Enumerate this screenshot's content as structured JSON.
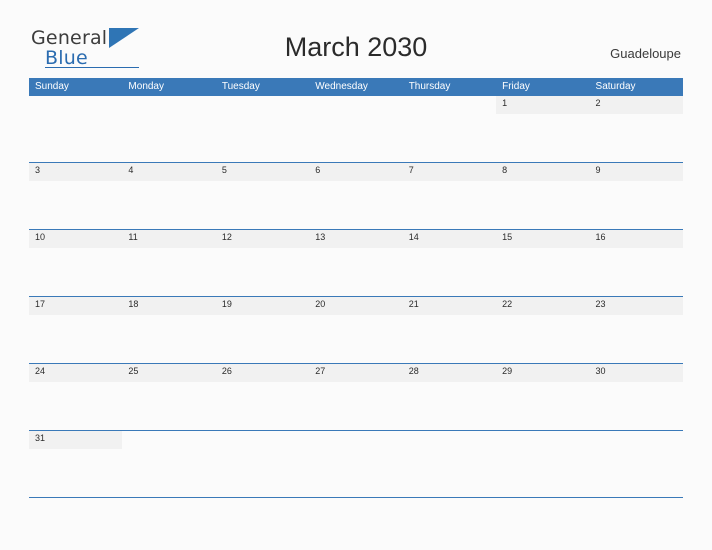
{
  "brand": {
    "line1": "General",
    "line2": "Blue",
    "flag_icon": "triangle-flag-icon"
  },
  "header": {
    "title": "March 2030",
    "locale": "Guadeloupe"
  },
  "calendar": {
    "weekdays": [
      "Sunday",
      "Monday",
      "Tuesday",
      "Wednesday",
      "Thursday",
      "Friday",
      "Saturday"
    ],
    "weeks": [
      [
        "",
        "",
        "",
        "",
        "",
        "1",
        "2"
      ],
      [
        "3",
        "4",
        "5",
        "6",
        "7",
        "8",
        "9"
      ],
      [
        "10",
        "11",
        "12",
        "13",
        "14",
        "15",
        "16"
      ],
      [
        "17",
        "18",
        "19",
        "20",
        "21",
        "22",
        "23"
      ],
      [
        "24",
        "25",
        "26",
        "27",
        "28",
        "29",
        "30"
      ],
      [
        "31",
        "",
        "",
        "",
        "",
        "",
        ""
      ]
    ]
  },
  "colors": {
    "header_blue": "#3a79b8",
    "brand_blue": "#2b6cb0",
    "cell_shade": "#f1f1f1",
    "page_bg": "#fbfbfb"
  }
}
